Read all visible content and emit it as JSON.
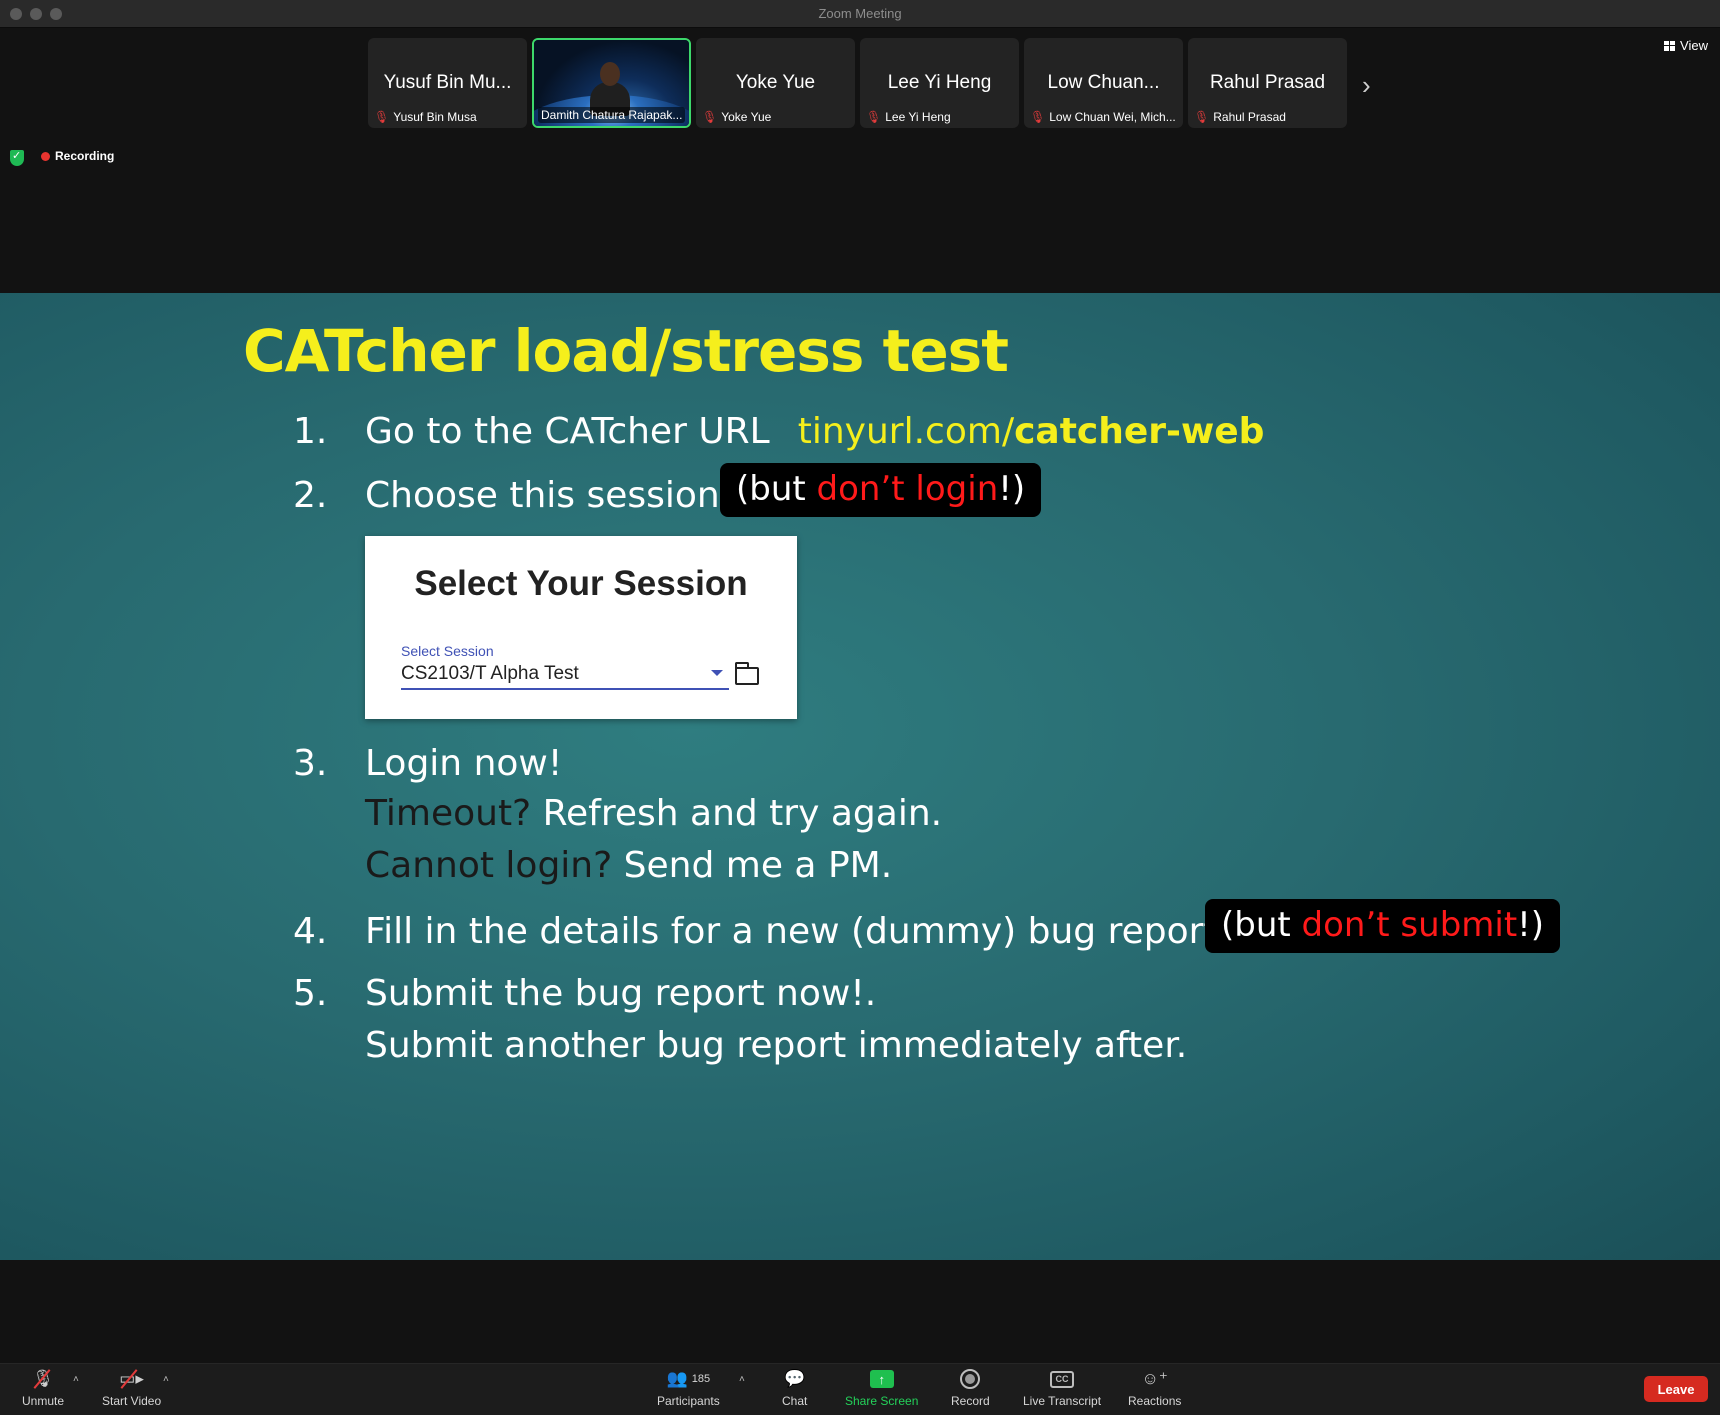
{
  "window": {
    "title": "Zoom Meeting"
  },
  "top_bar": {
    "view_label": "View",
    "recording_label": "Recording",
    "participants_tiles": [
      {
        "big_name": "Yusuf Bin Mu...",
        "small_name": "Yusuf Bin Musa",
        "muted": true
      },
      {
        "big_name": "",
        "small_name": "Damith Chatura Rajapak...",
        "muted": false,
        "video_on": true
      },
      {
        "big_name": "Yoke Yue",
        "small_name": "Yoke Yue",
        "muted": true
      },
      {
        "big_name": "Lee Yi Heng",
        "small_name": "Lee Yi Heng",
        "muted": true
      },
      {
        "big_name": "Low Chuan...",
        "small_name": "Low Chuan Wei, Mich...",
        "muted": true
      },
      {
        "big_name": "Rahul Prasad",
        "small_name": "Rahul Prasad",
        "muted": true
      }
    ]
  },
  "slide": {
    "title": "CATcher load/stress test",
    "step1": {
      "num": "1.",
      "text": "Go to the CATcher URL",
      "url_prefix": "tinyurl.com/",
      "url_bold": "catcher-web"
    },
    "step2": {
      "num": "2.",
      "text": "Choose this session",
      "callout_open": "(but ",
      "callout_red": "don’t login",
      "callout_close": "!)"
    },
    "session_card": {
      "heading": "Select Your Session",
      "field_label": "Select Session",
      "field_value": "CS2103/T Alpha Test"
    },
    "step3": {
      "num": "3.",
      "line1": "Login now!",
      "line2_dark": "Timeout?",
      "line2_rest": " Refresh and try again.",
      "line3_dark": "Cannot login?",
      "line3_rest": " Send me a PM."
    },
    "step4": {
      "num": "4.",
      "text": "Fill in the details for a new (dummy) bug report.",
      "callout_open": "(but ",
      "callout_red": "don’t submit",
      "callout_close": "!)"
    },
    "step5": {
      "num": "5.",
      "line1": "Submit the bug report now!.",
      "line2": "Submit another bug report immediately after."
    }
  },
  "toolbar": {
    "unmute": "Unmute",
    "start_video": "Start Video",
    "participants": "Participants",
    "participants_count": "185",
    "chat": "Chat",
    "share_screen": "Share Screen",
    "record": "Record",
    "live_transcript": "Live Transcript",
    "reactions": "Reactions",
    "leave": "Leave",
    "cc_icon_text": "CC"
  },
  "colors": {
    "slide_title": "#f5ef1c",
    "callout_red": "#ff1a1a",
    "share_green": "#1fbf4f",
    "leave_red": "#d62a20"
  }
}
